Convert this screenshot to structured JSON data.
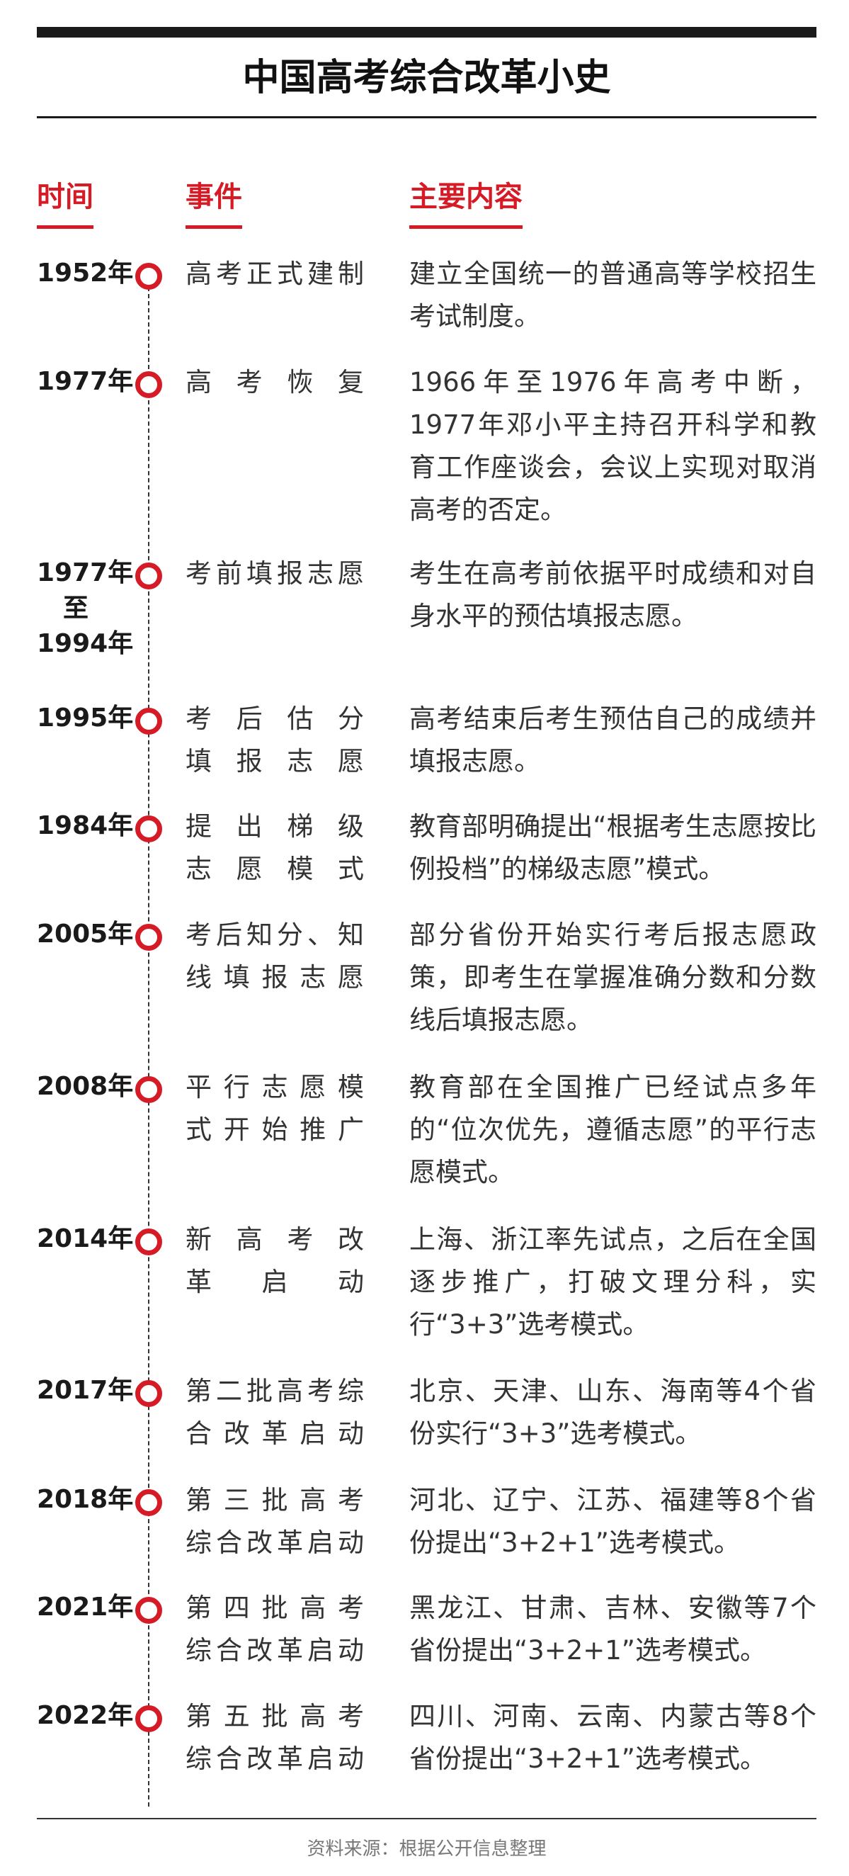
{
  "title": "中国高考综合改革小史",
  "headers": {
    "time": "时间",
    "event": "事件",
    "content": "主要内容"
  },
  "rows": [
    {
      "year": [
        "1952年"
      ],
      "event": [
        "高考正式建制"
      ],
      "content": "建立全国统一的普通高等学校招生考试制度。"
    },
    {
      "year": [
        "1977年"
      ],
      "event": [
        "高考恢复"
      ],
      "content": "1966年至1976年高考中断，1977年邓小平主持召开科学和教育工作座谈会，会议上实现对取消高考的否定。"
    },
    {
      "year": [
        "1977年",
        "至",
        "1994年"
      ],
      "event": [
        "考前填报志愿"
      ],
      "content": "考生在高考前依据平时成绩和对自身水平的预估填报志愿。"
    },
    {
      "year": [
        "1995年"
      ],
      "event": [
        "考后估分",
        "填报志愿"
      ],
      "content": "高考结束后考生预估自己的成绩并填报志愿。"
    },
    {
      "year": [
        "1984年"
      ],
      "event": [
        "提出梯级",
        "志愿模式"
      ],
      "content": "教育部明确提出“根据考生志愿按比例投档”的梯级志愿”模式。"
    },
    {
      "year": [
        "2005年"
      ],
      "event": [
        "考后知分、知",
        "线填报志愿"
      ],
      "content": "部分省份开始实行考后报志愿政策，即考生在掌握准确分数和分数线后填报志愿。"
    },
    {
      "year": [
        "2008年"
      ],
      "event": [
        "平行志愿模",
        "式开始推广"
      ],
      "content": "教育部在全国推广已经试点多年的“位次优先，遵循志愿”的平行志愿模式。"
    },
    {
      "year": [
        "2014年"
      ],
      "event": [
        "新高考改",
        "革启动"
      ],
      "content": "上海、浙江率先试点，之后在全国逐步推广，打破文理分科，实行“3+3”选考模式。"
    },
    {
      "year": [
        "2017年"
      ],
      "event": [
        "第二批高考综",
        "合改革启动"
      ],
      "content": "北京、天津、山东、海南等4个省份实行“3+3”选考模式。"
    },
    {
      "year": [
        "2018年"
      ],
      "event": [
        "第三批高考",
        "综合改革启动"
      ],
      "content": "河北、辽宁、江苏、福建等8个省份提出“3+2+1”选考模式。"
    },
    {
      "year": [
        "2021年"
      ],
      "event": [
        "第四批高考",
        "综合改革启动"
      ],
      "content": "黑龙江、甘肃、吉林、安徽等7个省份提出“3+2+1”选考模式。"
    },
    {
      "year": [
        "2022年"
      ],
      "event": [
        "第五批高考",
        "综合改革启动"
      ],
      "content": "四川、河南、云南、内蒙古等8个省份提出“3+2+1”选考模式。"
    }
  ],
  "source": "资料来源：根据公开信息整理",
  "colors": {
    "accent": "#d51b26",
    "text": "#333333"
  }
}
